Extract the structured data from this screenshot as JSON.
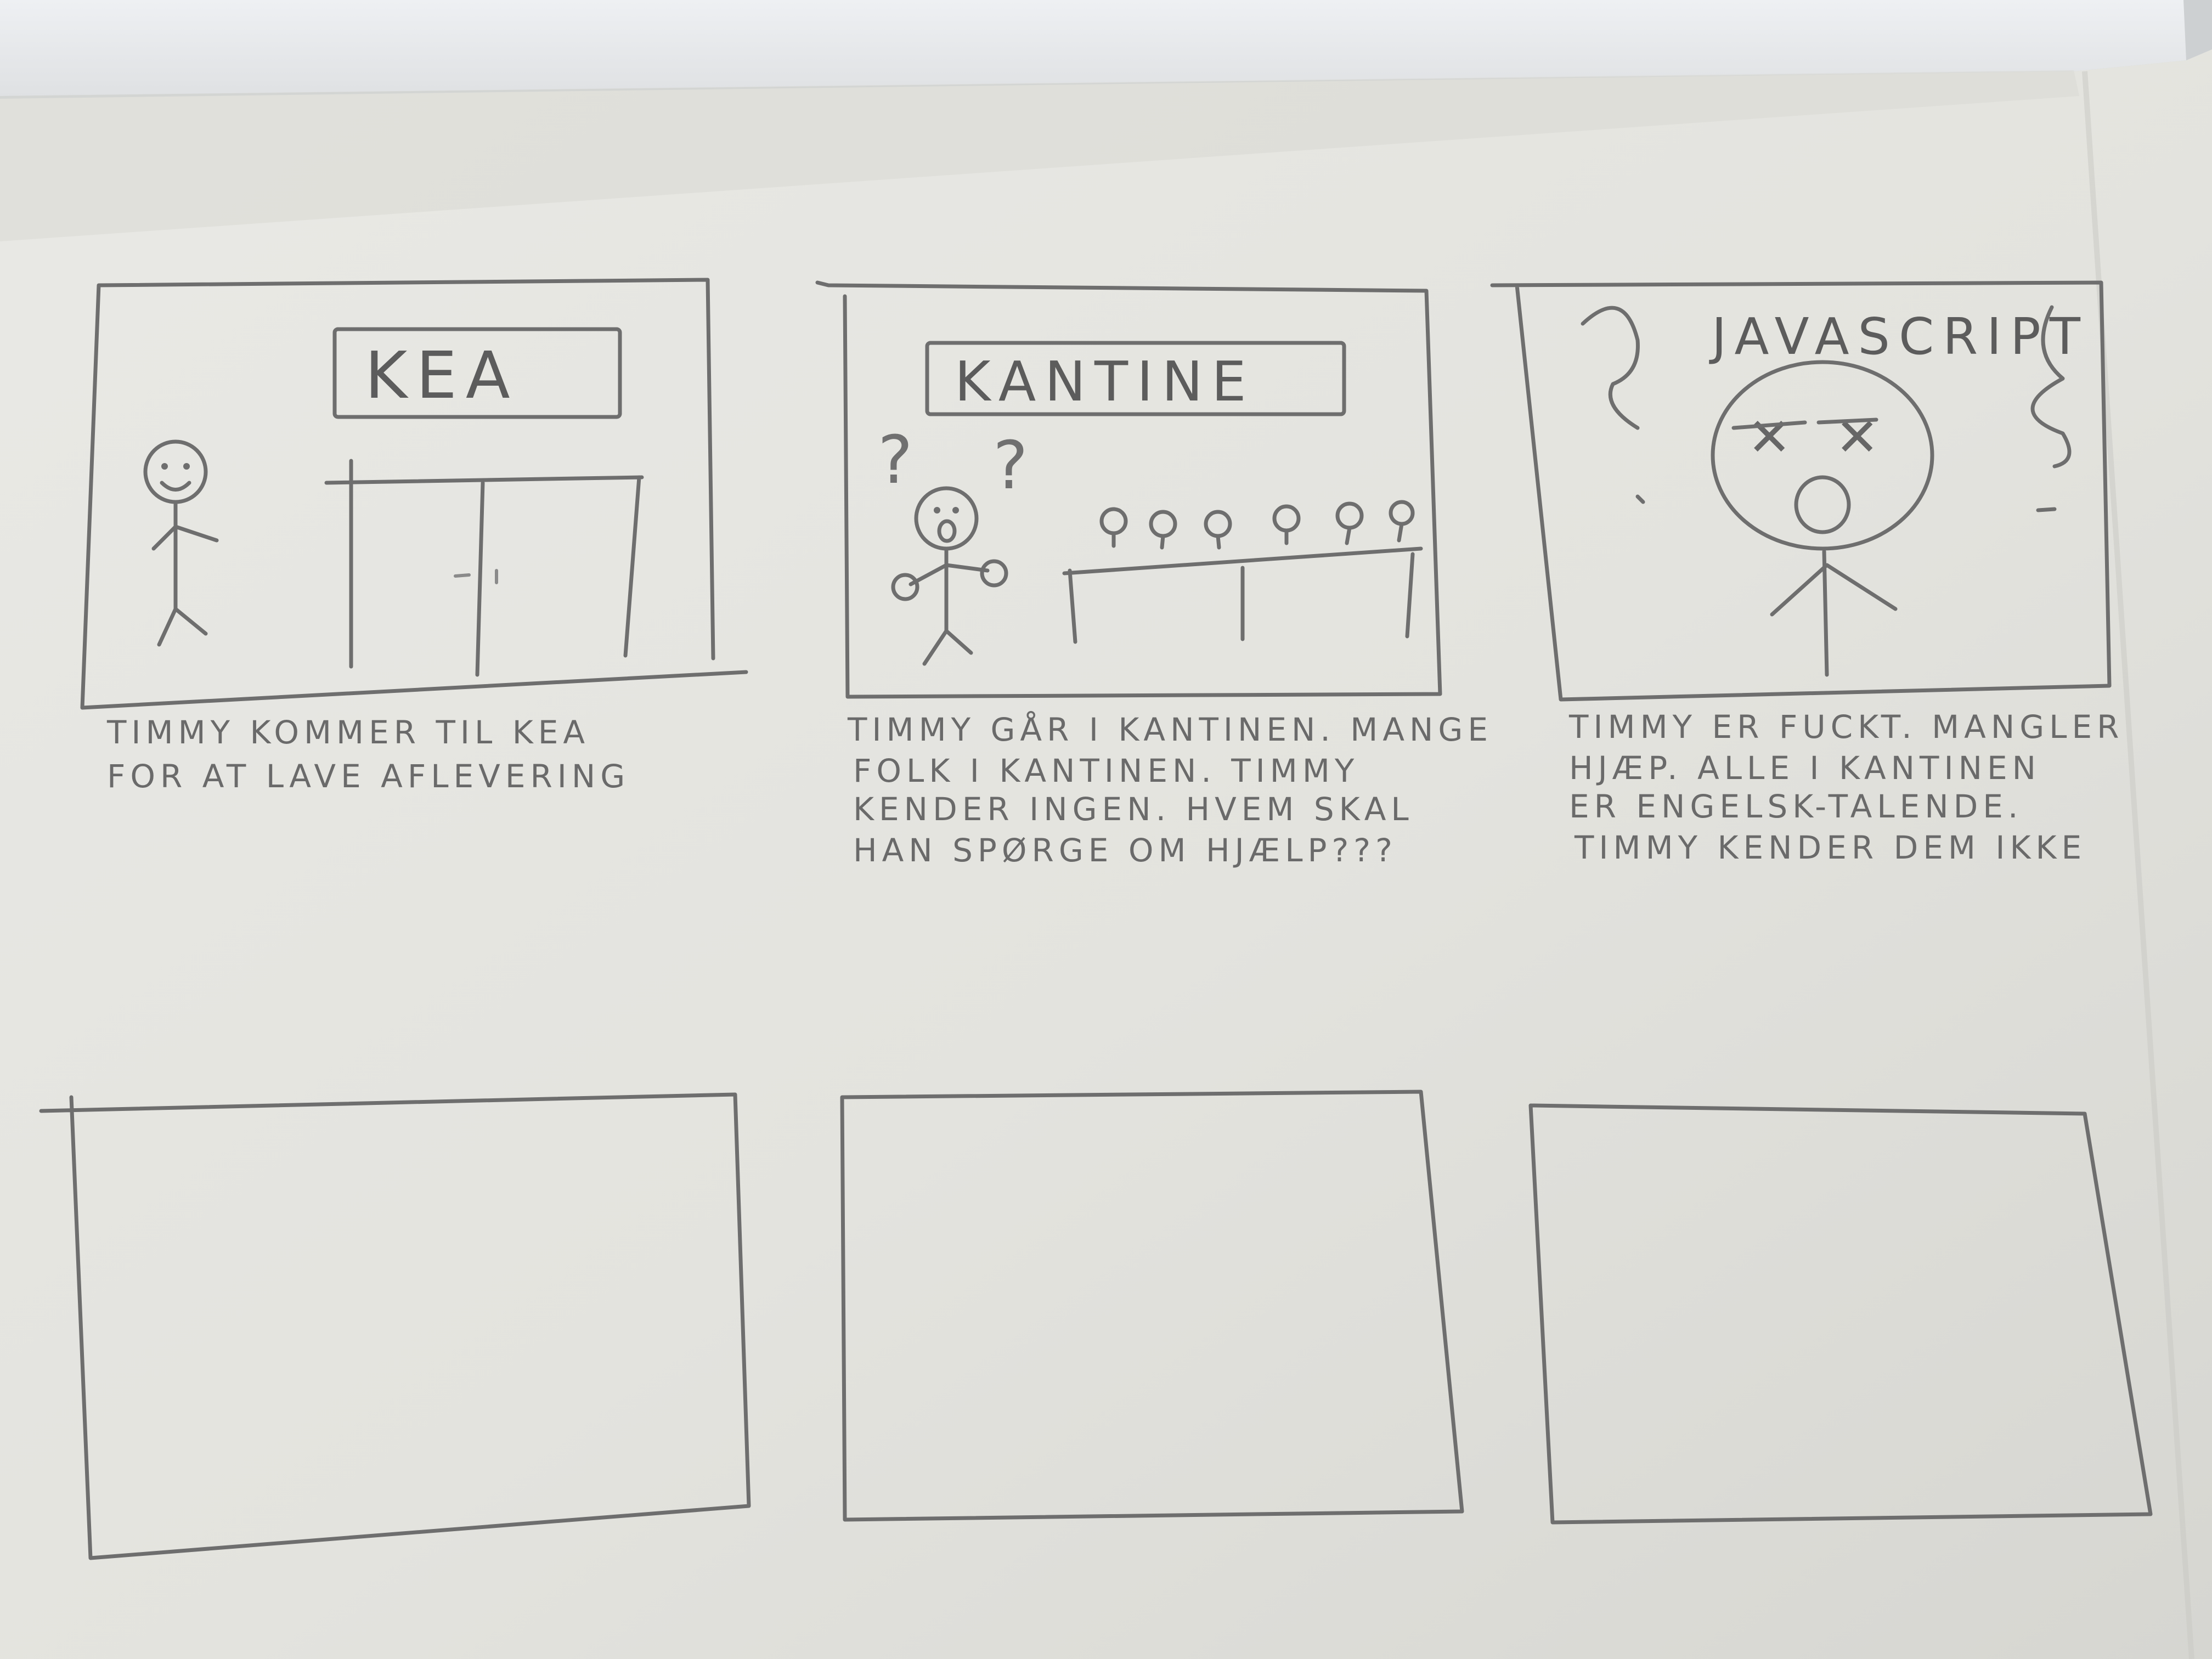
{
  "storyboard": {
    "panels": [
      {
        "sign": "KEA",
        "caption_lines": [
          "TIMMY KOMMER TIL KEA",
          "FOR AT LAVE AFLEVERING"
        ]
      },
      {
        "sign": "KANTINE",
        "caption_lines": [
          "TIMMY GÅR I KANTINEN. MANGE",
          "FOLK I KANTINEN. TIMMY",
          "KENDER INGEN. HVEM SKAL",
          "HAN SPØRGE OM HJÆLP???"
        ]
      },
      {
        "sign": "JAVASCRIPT",
        "caption_lines": [
          "TIMMY ER FUCKT. MANGLER",
          "HJÆP. ALLE I KANTINEN",
          "ER ENGELSK-TALENDE.",
          "TIMMY KENDER DEM IKKE"
        ]
      }
    ],
    "empty_panels": 3
  },
  "colors": {
    "paper": "#e6e6e1",
    "pencil": "#6e6e6e",
    "background": "#cfd1d3"
  }
}
